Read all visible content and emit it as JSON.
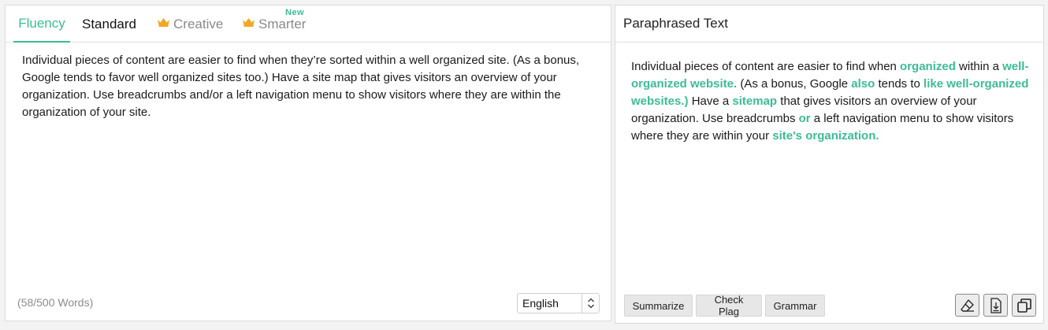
{
  "tabs": [
    {
      "label": "Fluency",
      "state": "active"
    },
    {
      "label": "Standard",
      "state": "available"
    },
    {
      "label": "Creative",
      "state": "premium"
    },
    {
      "label": "Smarter",
      "state": "premium"
    }
  ],
  "smarter_badge": "New",
  "input": {
    "text": "Individual pieces of content are easier to find when they’re sorted within a well organized site. (As a bonus, Google tends to favor well organized sites too.) Have a site map that gives visitors an overview of your organization. Use breadcrumbs and/or a left navigation menu to show visitors where they are within the organization of your site."
  },
  "word_count": "(58/500 Words)",
  "language": {
    "selected": "English"
  },
  "output": {
    "title": "Paraphrased Text",
    "segments": [
      {
        "text": "Individual pieces of content are easier to find when ",
        "changed": false
      },
      {
        "text": "organized",
        "changed": true
      },
      {
        "text": " within a ",
        "changed": false
      },
      {
        "text": "well-organized website.",
        "changed": true
      },
      {
        "text": " (As a bonus, Google ",
        "changed": false
      },
      {
        "text": "also",
        "changed": true
      },
      {
        "text": " tends to ",
        "changed": false
      },
      {
        "text": "like well-organized websites.)",
        "changed": true
      },
      {
        "text": " Have a ",
        "changed": false
      },
      {
        "text": "sitemap",
        "changed": true
      },
      {
        "text": " that gives visitors an overview of your organization. Use breadcrumbs ",
        "changed": false
      },
      {
        "text": "or",
        "changed": true
      },
      {
        "text": " a left navigation menu to show visitors where they are within  your ",
        "changed": false
      },
      {
        "text": "site's organization.",
        "changed": true
      }
    ]
  },
  "actions": {
    "summarize": "Summarize",
    "check_plag": "Check Plag",
    "grammar": "Grammar"
  },
  "icons": {
    "crown": "crown-icon",
    "clear": "eraser-icon",
    "download": "download-icon",
    "copy": "copy-icon"
  },
  "colors": {
    "accent": "#3cbc97",
    "crown": "#f5a623",
    "muted": "#8a8a8a"
  }
}
